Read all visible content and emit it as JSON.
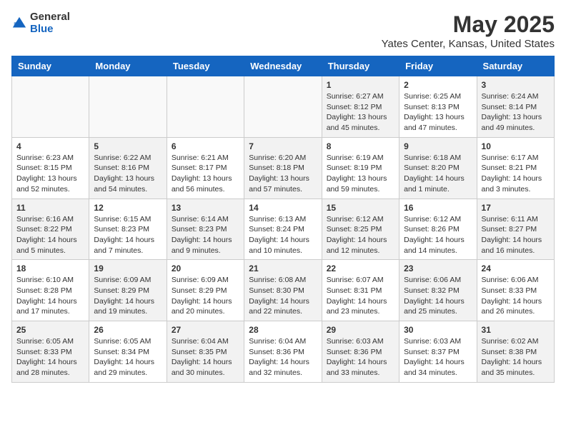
{
  "header": {
    "logo_general": "General",
    "logo_blue": "Blue",
    "title": "May 2025",
    "subtitle": "Yates Center, Kansas, United States"
  },
  "weekdays": [
    "Sunday",
    "Monday",
    "Tuesday",
    "Wednesday",
    "Thursday",
    "Friday",
    "Saturday"
  ],
  "weeks": [
    [
      {
        "day": "",
        "info": "",
        "empty": true
      },
      {
        "day": "",
        "info": "",
        "empty": true
      },
      {
        "day": "",
        "info": "",
        "empty": true
      },
      {
        "day": "",
        "info": "",
        "empty": true
      },
      {
        "day": "1",
        "info": "Sunrise: 6:27 AM\nSunset: 8:12 PM\nDaylight: 13 hours\nand 45 minutes."
      },
      {
        "day": "2",
        "info": "Sunrise: 6:25 AM\nSunset: 8:13 PM\nDaylight: 13 hours\nand 47 minutes."
      },
      {
        "day": "3",
        "info": "Sunrise: 6:24 AM\nSunset: 8:14 PM\nDaylight: 13 hours\nand 49 minutes."
      }
    ],
    [
      {
        "day": "4",
        "info": "Sunrise: 6:23 AM\nSunset: 8:15 PM\nDaylight: 13 hours\nand 52 minutes."
      },
      {
        "day": "5",
        "info": "Sunrise: 6:22 AM\nSunset: 8:16 PM\nDaylight: 13 hours\nand 54 minutes."
      },
      {
        "day": "6",
        "info": "Sunrise: 6:21 AM\nSunset: 8:17 PM\nDaylight: 13 hours\nand 56 minutes."
      },
      {
        "day": "7",
        "info": "Sunrise: 6:20 AM\nSunset: 8:18 PM\nDaylight: 13 hours\nand 57 minutes."
      },
      {
        "day": "8",
        "info": "Sunrise: 6:19 AM\nSunset: 8:19 PM\nDaylight: 13 hours\nand 59 minutes."
      },
      {
        "day": "9",
        "info": "Sunrise: 6:18 AM\nSunset: 8:20 PM\nDaylight: 14 hours\nand 1 minute."
      },
      {
        "day": "10",
        "info": "Sunrise: 6:17 AM\nSunset: 8:21 PM\nDaylight: 14 hours\nand 3 minutes."
      }
    ],
    [
      {
        "day": "11",
        "info": "Sunrise: 6:16 AM\nSunset: 8:22 PM\nDaylight: 14 hours\nand 5 minutes."
      },
      {
        "day": "12",
        "info": "Sunrise: 6:15 AM\nSunset: 8:23 PM\nDaylight: 14 hours\nand 7 minutes."
      },
      {
        "day": "13",
        "info": "Sunrise: 6:14 AM\nSunset: 8:23 PM\nDaylight: 14 hours\nand 9 minutes."
      },
      {
        "day": "14",
        "info": "Sunrise: 6:13 AM\nSunset: 8:24 PM\nDaylight: 14 hours\nand 10 minutes."
      },
      {
        "day": "15",
        "info": "Sunrise: 6:12 AM\nSunset: 8:25 PM\nDaylight: 14 hours\nand 12 minutes."
      },
      {
        "day": "16",
        "info": "Sunrise: 6:12 AM\nSunset: 8:26 PM\nDaylight: 14 hours\nand 14 minutes."
      },
      {
        "day": "17",
        "info": "Sunrise: 6:11 AM\nSunset: 8:27 PM\nDaylight: 14 hours\nand 16 minutes."
      }
    ],
    [
      {
        "day": "18",
        "info": "Sunrise: 6:10 AM\nSunset: 8:28 PM\nDaylight: 14 hours\nand 17 minutes."
      },
      {
        "day": "19",
        "info": "Sunrise: 6:09 AM\nSunset: 8:29 PM\nDaylight: 14 hours\nand 19 minutes."
      },
      {
        "day": "20",
        "info": "Sunrise: 6:09 AM\nSunset: 8:29 PM\nDaylight: 14 hours\nand 20 minutes."
      },
      {
        "day": "21",
        "info": "Sunrise: 6:08 AM\nSunset: 8:30 PM\nDaylight: 14 hours\nand 22 minutes."
      },
      {
        "day": "22",
        "info": "Sunrise: 6:07 AM\nSunset: 8:31 PM\nDaylight: 14 hours\nand 23 minutes."
      },
      {
        "day": "23",
        "info": "Sunrise: 6:06 AM\nSunset: 8:32 PM\nDaylight: 14 hours\nand 25 minutes."
      },
      {
        "day": "24",
        "info": "Sunrise: 6:06 AM\nSunset: 8:33 PM\nDaylight: 14 hours\nand 26 minutes."
      }
    ],
    [
      {
        "day": "25",
        "info": "Sunrise: 6:05 AM\nSunset: 8:33 PM\nDaylight: 14 hours\nand 28 minutes."
      },
      {
        "day": "26",
        "info": "Sunrise: 6:05 AM\nSunset: 8:34 PM\nDaylight: 14 hours\nand 29 minutes."
      },
      {
        "day": "27",
        "info": "Sunrise: 6:04 AM\nSunset: 8:35 PM\nDaylight: 14 hours\nand 30 minutes."
      },
      {
        "day": "28",
        "info": "Sunrise: 6:04 AM\nSunset: 8:36 PM\nDaylight: 14 hours\nand 32 minutes."
      },
      {
        "day": "29",
        "info": "Sunrise: 6:03 AM\nSunset: 8:36 PM\nDaylight: 14 hours\nand 33 minutes."
      },
      {
        "day": "30",
        "info": "Sunrise: 6:03 AM\nSunset: 8:37 PM\nDaylight: 14 hours\nand 34 minutes."
      },
      {
        "day": "31",
        "info": "Sunrise: 6:02 AM\nSunset: 8:38 PM\nDaylight: 14 hours\nand 35 minutes."
      }
    ]
  ]
}
